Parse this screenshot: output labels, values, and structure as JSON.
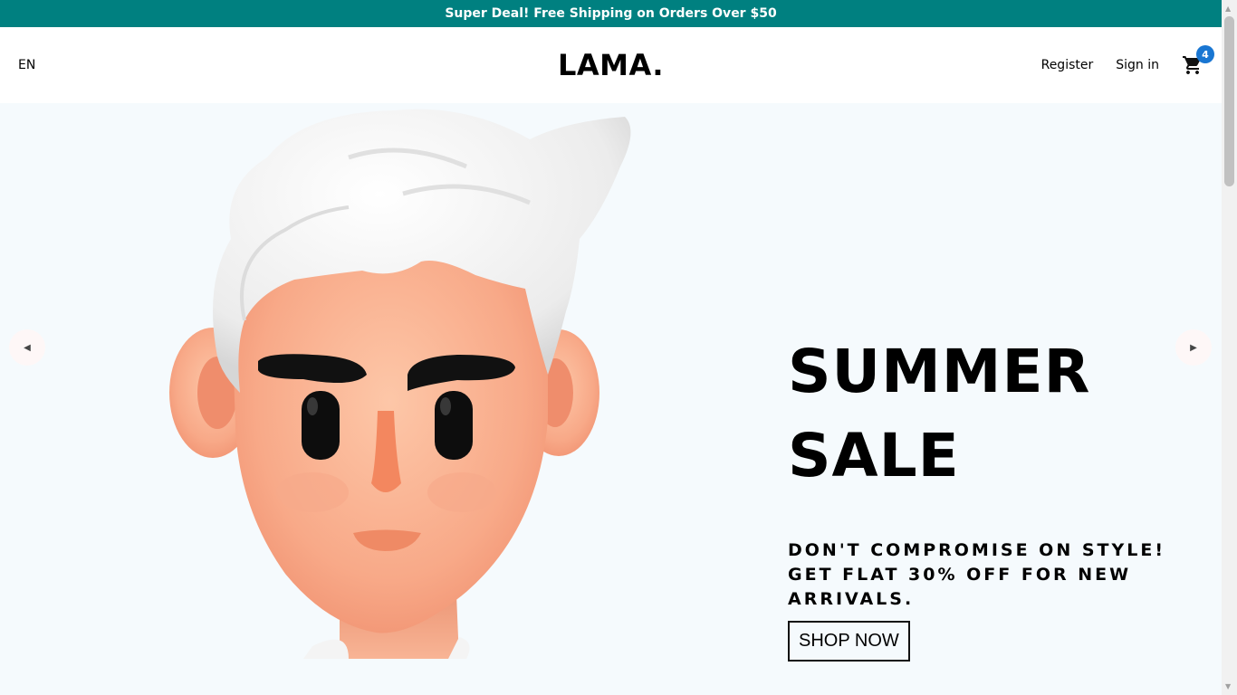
{
  "announcement": {
    "text": "Super Deal! Free Shipping on Orders Over $50",
    "bg_color": "#008080"
  },
  "navbar": {
    "language": "EN",
    "logo": "LAMA.",
    "register_label": "Register",
    "signin_label": "Sign in",
    "cart": {
      "icon": "shopping-cart-icon",
      "badge_count": "4",
      "badge_color": "#1976d2"
    }
  },
  "slider": {
    "bg_color": "#f5fafd",
    "prev_icon": "arrow-left-icon",
    "next_icon": "arrow-right-icon",
    "slide": {
      "image": "3d-character-with-white-hair",
      "title_line1": "SUMMER",
      "title_line2": "SALE",
      "description": "DON'T COMPROMISE ON STYLE! GET FLAT 30% OFF FOR NEW ARRIVALS.",
      "button_label": "SHOP NOW"
    }
  }
}
